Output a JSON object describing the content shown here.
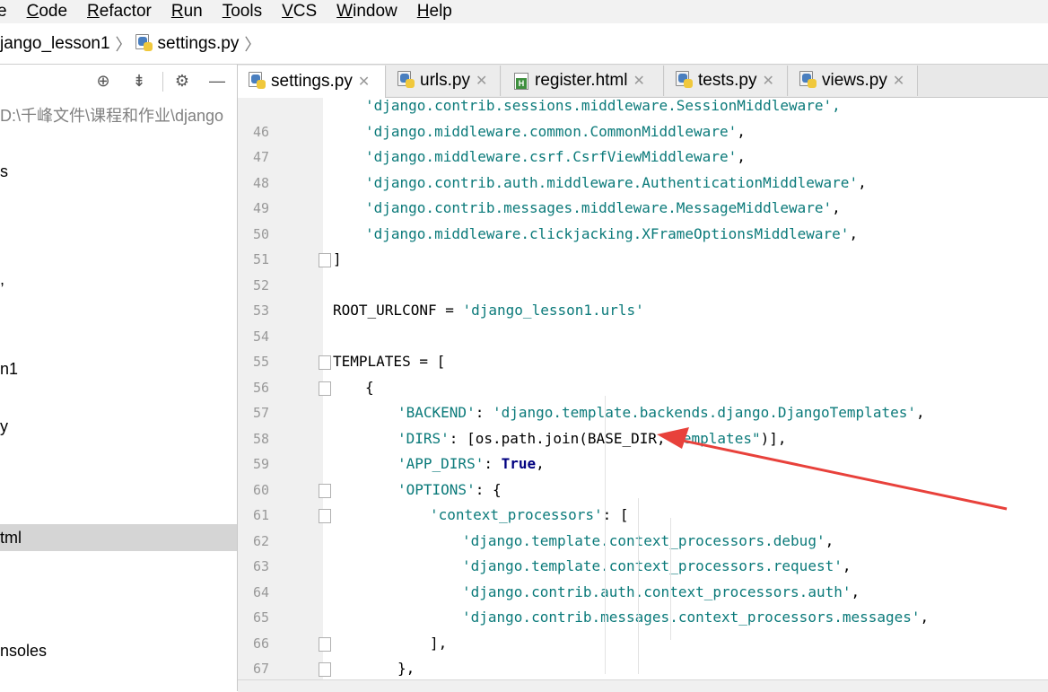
{
  "menubar": {
    "items": [
      {
        "label": "e",
        "underline": ""
      },
      {
        "label": "Code",
        "underline": "C"
      },
      {
        "label": "Refactor",
        "underline": "R"
      },
      {
        "label": "Run",
        "underline": "R"
      },
      {
        "label": "Tools",
        "underline": "T"
      },
      {
        "label": "VCS",
        "underline": "V"
      },
      {
        "label": "Window",
        "underline": "W"
      },
      {
        "label": "Help",
        "underline": "H"
      }
    ]
  },
  "breadcrumb": {
    "project": "jango_lesson1",
    "file": "settings.py"
  },
  "left_panel": {
    "toolbar_icons": [
      "target-icon",
      "collapse-icon",
      "gear-icon",
      "minus-icon"
    ],
    "tree": [
      {
        "label": "D:\\千峰文件\\课程和作业\\django",
        "muted": true
      },
      {
        "label": "s"
      },
      {
        "label": ","
      },
      {
        "label": "n1"
      },
      {
        "label": "y"
      },
      {
        "label": "tml",
        "selected": true
      },
      {
        "label": "nsoles"
      }
    ]
  },
  "tabs": [
    {
      "label": "settings.py",
      "icon": "python-file-icon",
      "active": true
    },
    {
      "label": "urls.py",
      "icon": "python-file-icon",
      "active": false
    },
    {
      "label": "register.html",
      "icon": "html-file-icon",
      "active": false
    },
    {
      "label": "tests.py",
      "icon": "python-file-icon",
      "active": false
    },
    {
      "label": "views.py",
      "icon": "python-file-icon",
      "active": false
    }
  ],
  "editor": {
    "lines": [
      {
        "num": "",
        "indent": 4,
        "segments": [
          {
            "t": "'django.contrib.sessions.middleware.SessionMiddleware',",
            "c": "str"
          }
        ],
        "partial": true
      },
      {
        "num": "46",
        "indent": 4,
        "segments": [
          {
            "t": "'django.middleware.common.CommonMiddleware'",
            "c": "str"
          },
          {
            "t": ",",
            "c": ""
          }
        ]
      },
      {
        "num": "47",
        "indent": 4,
        "segments": [
          {
            "t": "'django.middleware.csrf.CsrfViewMiddleware'",
            "c": "str"
          },
          {
            "t": ",",
            "c": ""
          }
        ]
      },
      {
        "num": "48",
        "indent": 4,
        "segments": [
          {
            "t": "'django.contrib.auth.middleware.AuthenticationMiddleware'",
            "c": "str"
          },
          {
            "t": ",",
            "c": ""
          }
        ]
      },
      {
        "num": "49",
        "indent": 4,
        "segments": [
          {
            "t": "'django.contrib.messages.middleware.MessageMiddleware'",
            "c": "str"
          },
          {
            "t": ",",
            "c": ""
          }
        ]
      },
      {
        "num": "50",
        "indent": 4,
        "segments": [
          {
            "t": "'django.middleware.clickjacking.XFrameOptionsMiddleware'",
            "c": "str"
          },
          {
            "t": ",",
            "c": ""
          }
        ]
      },
      {
        "num": "51",
        "indent": 0,
        "segments": [
          {
            "t": "]",
            "c": ""
          }
        ],
        "fold": true
      },
      {
        "num": "52",
        "indent": 0,
        "segments": []
      },
      {
        "num": "53",
        "indent": 0,
        "segments": [
          {
            "t": "ROOT_URLCONF = ",
            "c": ""
          },
          {
            "t": "'django_lesson1.urls'",
            "c": "str"
          }
        ]
      },
      {
        "num": "54",
        "indent": 0,
        "segments": []
      },
      {
        "num": "55",
        "indent": 0,
        "segments": [
          {
            "t": "TEMPLATES = [",
            "c": ""
          }
        ],
        "fold": true
      },
      {
        "num": "56",
        "indent": 4,
        "segments": [
          {
            "t": "{",
            "c": ""
          }
        ],
        "fold": true
      },
      {
        "num": "57",
        "indent": 8,
        "segments": [
          {
            "t": "'BACKEND'",
            "c": "str"
          },
          {
            "t": ": ",
            "c": ""
          },
          {
            "t": "'django.template.backends.django.DjangoTemplates'",
            "c": "str"
          },
          {
            "t": ",",
            "c": ""
          }
        ]
      },
      {
        "num": "58",
        "indent": 8,
        "segments": [
          {
            "t": "'DIRS'",
            "c": "str"
          },
          {
            "t": ": [os.path.join(BASE_DIR,",
            "c": ""
          },
          {
            "t": "\"templates\"",
            "c": "str"
          },
          {
            "t": ")],",
            "c": ""
          }
        ]
      },
      {
        "num": "59",
        "indent": 8,
        "segments": [
          {
            "t": "'APP_DIRS'",
            "c": "str"
          },
          {
            "t": ": ",
            "c": ""
          },
          {
            "t": "True",
            "c": "kw"
          },
          {
            "t": ",",
            "c": ""
          }
        ]
      },
      {
        "num": "60",
        "indent": 8,
        "segments": [
          {
            "t": "'OPTIONS'",
            "c": "str"
          },
          {
            "t": ": {",
            "c": ""
          }
        ],
        "fold": true
      },
      {
        "num": "61",
        "indent": 12,
        "segments": [
          {
            "t": "'context_processors'",
            "c": "str"
          },
          {
            "t": ": [",
            "c": ""
          }
        ],
        "fold": true
      },
      {
        "num": "62",
        "indent": 16,
        "segments": [
          {
            "t": "'django.template.context_processors.debug'",
            "c": "str"
          },
          {
            "t": ",",
            "c": ""
          }
        ]
      },
      {
        "num": "63",
        "indent": 16,
        "segments": [
          {
            "t": "'django.template.context_processors.request'",
            "c": "str"
          },
          {
            "t": ",",
            "c": ""
          }
        ]
      },
      {
        "num": "64",
        "indent": 16,
        "segments": [
          {
            "t": "'django.contrib.auth.context_processors.auth'",
            "c": "str"
          },
          {
            "t": ",",
            "c": ""
          }
        ]
      },
      {
        "num": "65",
        "indent": 16,
        "segments": [
          {
            "t": "'django.contrib.messages.context_processors.messages'",
            "c": "str"
          },
          {
            "t": ",",
            "c": ""
          }
        ]
      },
      {
        "num": "66",
        "indent": 12,
        "segments": [
          {
            "t": "],",
            "c": ""
          }
        ],
        "fold": true
      },
      {
        "num": "67",
        "indent": 8,
        "segments": [
          {
            "t": "},",
            "c": ""
          }
        ],
        "fold": true
      }
    ]
  },
  "colors": {
    "string": "#0b7a7a",
    "keyword": "#000080",
    "arrow": "#e8413b",
    "selection": "#d5d5d5"
  }
}
